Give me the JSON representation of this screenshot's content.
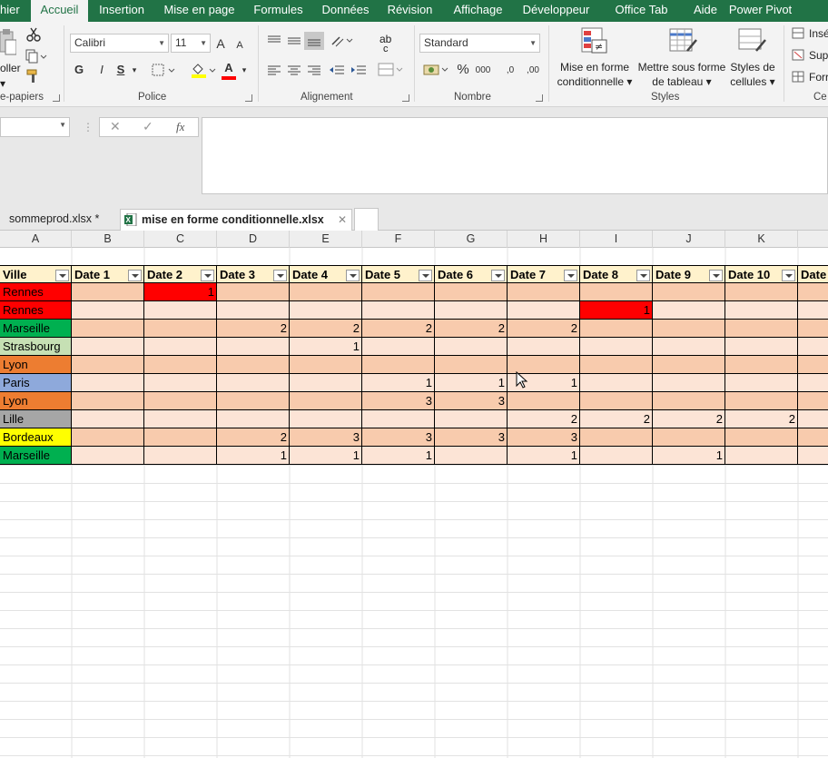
{
  "ribbon_tabs": [
    {
      "label": "hier",
      "active": false
    },
    {
      "label": "Accueil",
      "active": true
    },
    {
      "label": "Insertion",
      "active": false
    },
    {
      "label": "Mise en page",
      "active": false
    },
    {
      "label": "Formules",
      "active": false
    },
    {
      "label": "Données",
      "active": false
    },
    {
      "label": "Révision",
      "active": false
    },
    {
      "label": "Affichage",
      "active": false
    },
    {
      "label": "Développeur",
      "active": false
    },
    {
      "label": "Office Tab",
      "active": false
    },
    {
      "label": "Aide",
      "active": false
    },
    {
      "label": "Power Pivot",
      "active": false
    }
  ],
  "clipboard": {
    "paste_label": "oller",
    "group_label": "e-papiers"
  },
  "font": {
    "name": "Calibri",
    "size": "11",
    "bold": "G",
    "italic": "I",
    "underline": "S",
    "grow": "A",
    "shrink": "A",
    "color_letter": "A",
    "group_label": "Police"
  },
  "alignment": {
    "wrap_label": "ab",
    "wrap_sub": "c",
    "group_label": "Alignement"
  },
  "number": {
    "format": "Standard",
    "percent": "%",
    "thousands": "000",
    "inc_dec": ",0",
    "dec_dec": ",00",
    "group_label": "Nombre"
  },
  "styles": {
    "conditional": [
      "Mise en forme",
      "conditionnelle"
    ],
    "table": [
      "Mettre sous forme",
      "de tableau"
    ],
    "cell": [
      "Styles de",
      "cellules"
    ],
    "group_label": "Styles"
  },
  "cells_group": {
    "insert": "Insé",
    "delete": "Sup",
    "format": "Forr",
    "group_label": "Ce"
  },
  "formula_bar": {
    "fx": "fx",
    "cancel": "✕",
    "confirm": "✓"
  },
  "workbook_tabs": [
    {
      "label": "sommeprod.xlsx *",
      "active": false
    },
    {
      "label": "mise en forme conditionnelle.xlsx",
      "active": true
    }
  ],
  "columns": [
    "A",
    "B",
    "C",
    "D",
    "E",
    "F",
    "G",
    "H",
    "I",
    "J",
    "K",
    ""
  ],
  "table_header": [
    "Ville",
    "Date 1",
    "Date 2",
    "Date 3",
    "Date 4",
    "Date 5",
    "Date 6",
    "Date 7",
    "Date 8",
    "Date 9",
    "Date 10",
    "Date"
  ],
  "rows": [
    {
      "city": "Rennes",
      "color": "#ff0000",
      "values": [
        "",
        "1",
        "",
        "",
        "",
        "",
        "",
        "",
        "",
        "",
        ""
      ],
      "hot": [
        1
      ]
    },
    {
      "city": "Rennes",
      "color": "#ff0000",
      "values": [
        "",
        "",
        "",
        "",
        "",
        "",
        "",
        "1",
        "",
        "",
        ""
      ],
      "hot": [
        7
      ]
    },
    {
      "city": "Marseille",
      "color": "#00b050",
      "values": [
        "",
        "",
        "2",
        "2",
        "2",
        "2",
        "2",
        "",
        "",
        "",
        ""
      ],
      "hot": []
    },
    {
      "city": "Strasbourg",
      "color": "#c6e0b4",
      "values": [
        "",
        "",
        "",
        "1",
        "",
        "",
        "",
        "",
        "",
        "",
        ""
      ],
      "hot": []
    },
    {
      "city": "Lyon",
      "color": "#ed7d31",
      "values": [
        "",
        "",
        "",
        "",
        "",
        "",
        "",
        "",
        "",
        "",
        ""
      ],
      "hot": []
    },
    {
      "city": "Paris",
      "color": "#8ea9db",
      "values": [
        "",
        "",
        "",
        "",
        "1",
        "1",
        "1",
        "",
        "",
        "",
        ""
      ],
      "hot": []
    },
    {
      "city": "Lyon",
      "color": "#ed7d31",
      "values": [
        "",
        "",
        "",
        "",
        "3",
        "3",
        "",
        "",
        "",
        "",
        ""
      ],
      "hot": []
    },
    {
      "city": "Lille",
      "color": "#a6a6a6",
      "values": [
        "",
        "",
        "",
        "",
        "",
        "",
        "2",
        "2",
        "2",
        "2",
        ""
      ],
      "hot": []
    },
    {
      "city": "Bordeaux",
      "color": "#ffff00",
      "values": [
        "",
        "",
        "2",
        "3",
        "3",
        "3",
        "3",
        "",
        "",
        "",
        ""
      ],
      "hot": []
    },
    {
      "city": "Marseille",
      "color": "#00b050",
      "values": [
        "",
        "",
        "1",
        "1",
        "1",
        "",
        "1",
        "",
        "1",
        "",
        ""
      ],
      "hot": []
    }
  ],
  "colors": {
    "accent": "#217346",
    "band_dark": "#f8cbad",
    "band_light": "#fce4d6",
    "header_fill": "#fff2cc",
    "hot": "#ff0000"
  }
}
